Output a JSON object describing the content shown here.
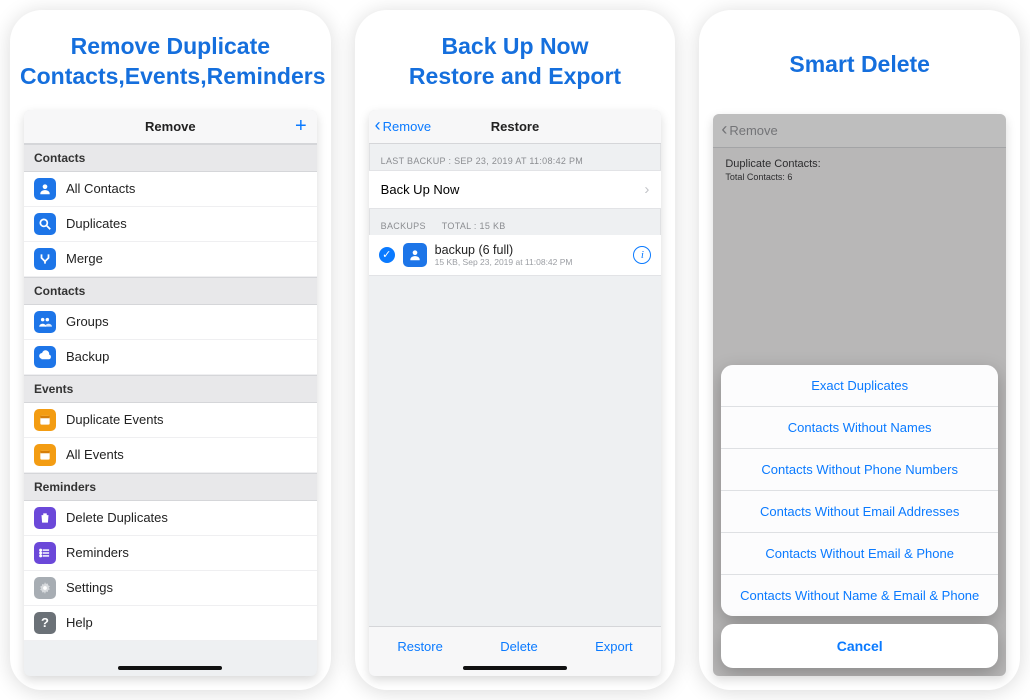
{
  "panels": {
    "left": {
      "hero_line1": "Remove Duplicate",
      "hero_line2": "Contacts,Events,Reminders",
      "nav_title": "Remove",
      "sections": {
        "contacts1": "Contacts",
        "contacts2": "Contacts",
        "events": "Events",
        "reminders": "Reminders"
      },
      "rows": {
        "all_contacts": "All Contacts",
        "duplicates": "Duplicates",
        "merge": "Merge",
        "groups": "Groups",
        "backup": "Backup",
        "dup_events": "Duplicate Events",
        "all_events": "All Events",
        "delete_dups": "Delete Duplicates",
        "reminders_row": "Reminders",
        "settings": "Settings",
        "help": "Help"
      }
    },
    "mid": {
      "hero_line1": "Back Up Now",
      "hero_line2": "Restore and Export",
      "nav_back": "Remove",
      "nav_title": "Restore",
      "last_backup_label": "LAST BACKUP : SEP 23, 2019 AT 11:08:42 PM",
      "backup_now": "Back Up Now",
      "backups_label": "BACKUPS",
      "backups_total": "TOTAL : 15 KB",
      "backup_entry_title": "backup (6 full)",
      "backup_entry_sub": "15 KB, Sep 23, 2019 at 11:08:42 PM",
      "toolbar": {
        "restore": "Restore",
        "delete": "Delete",
        "export": "Export"
      }
    },
    "right": {
      "hero": "Smart Delete",
      "nav_back": "Remove",
      "dup_heading": "Duplicate Contacts:",
      "dup_sub": "Total Contacts: 6",
      "sheet": {
        "o1": "Exact Duplicates",
        "o2": "Contacts Without Names",
        "o3": "Contacts Without Phone Numbers",
        "o4": "Contacts Without Email Addresses",
        "o5": "Contacts Without Email & Phone",
        "o6": "Contacts Without Name & Email & Phone",
        "cancel": "Cancel"
      }
    }
  }
}
